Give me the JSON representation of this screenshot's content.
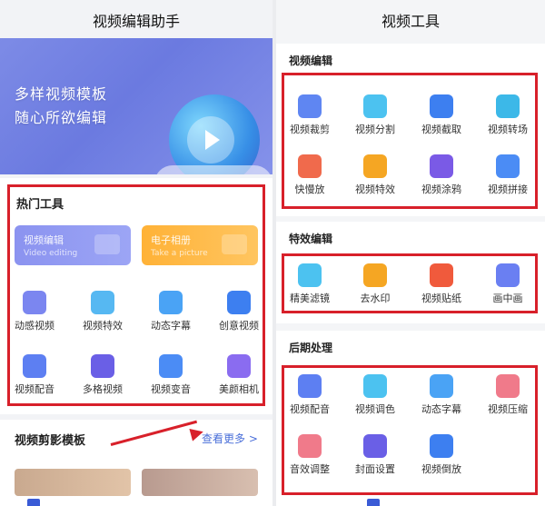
{
  "left": {
    "title": "视频编辑助手",
    "banner": {
      "line1": "多样视频模板",
      "line2": "随心所欲编辑"
    },
    "hot_tools": {
      "title": "热门工具",
      "big_buttons": [
        {
          "label": "视频编辑",
          "sub": "Video editing",
          "color": "#8b93f0"
        },
        {
          "label": "电子相册",
          "sub": "Take a picture",
          "color": "#ffb237"
        }
      ],
      "items": [
        {
          "label": "动感视频",
          "icon": "video-motion-icon",
          "color": "#7b86f0"
        },
        {
          "label": "视频特效",
          "icon": "video-effect-icon",
          "color": "#56b8f2"
        },
        {
          "label": "动态字幕",
          "icon": "subtitle-icon",
          "color": "#4aa3f5"
        },
        {
          "label": "创意视频",
          "icon": "api-icon",
          "color": "#3d7ff0"
        },
        {
          "label": "视频配音",
          "icon": "voiceover-icon",
          "color": "#5d7ff2"
        },
        {
          "label": "多格视频",
          "icon": "grid-video-icon",
          "color": "#6a5fe6"
        },
        {
          "label": "视频变音",
          "icon": "voice-change-icon",
          "color": "#4b8cf5"
        },
        {
          "label": "美颜相机",
          "icon": "beauty-camera-icon",
          "color": "#8a6cf0"
        }
      ]
    },
    "templates": {
      "title": "视频剪影模板",
      "more": "查看更多 >"
    }
  },
  "right": {
    "title": "视频工具",
    "sections": [
      {
        "title": "视频编辑",
        "items": [
          {
            "label": "视频裁剪",
            "icon": "crop-icon",
            "color": "#5f86f2"
          },
          {
            "label": "视频分割",
            "icon": "split-icon",
            "color": "#4cc2f0"
          },
          {
            "label": "视频截取",
            "icon": "capture-icon",
            "color": "#3d7ff0"
          },
          {
            "label": "视频转场",
            "icon": "transition-icon",
            "color": "#3cb8e8"
          },
          {
            "label": "快慢放",
            "icon": "speed-icon",
            "color": "#f06a4c"
          },
          {
            "label": "视频特效",
            "icon": "effect-icon",
            "color": "#f5a623"
          },
          {
            "label": "视频涂鸦",
            "icon": "doodle-icon",
            "color": "#7a5ae6"
          },
          {
            "label": "视频拼接",
            "icon": "splice-icon",
            "color": "#4b8cf5"
          }
        ]
      },
      {
        "title": "特效编辑",
        "items": [
          {
            "label": "精美滤镜",
            "icon": "filter-icon",
            "color": "#4cc2f0"
          },
          {
            "label": "去水印",
            "icon": "watermark-icon",
            "color": "#f5a623"
          },
          {
            "label": "视频贴纸",
            "icon": "sticker-icon",
            "color": "#f05a3c"
          },
          {
            "label": "画中画",
            "icon": "pip-icon",
            "color": "#6a7ff2"
          }
        ]
      },
      {
        "title": "后期处理",
        "items": [
          {
            "label": "视频配音",
            "icon": "dub-icon",
            "color": "#5d7ff2"
          },
          {
            "label": "视频调色",
            "icon": "color-grade-icon",
            "color": "#4cc2f0"
          },
          {
            "label": "动态字幕",
            "icon": "dynamic-subtitle-icon",
            "color": "#4aa3f5"
          },
          {
            "label": "视频压缩",
            "icon": "compress-icon",
            "color": "#f07a8a"
          },
          {
            "label": "音效调整",
            "icon": "sound-adjust-icon",
            "color": "#f07a8a"
          },
          {
            "label": "封面设置",
            "icon": "cover-icon",
            "color": "#6a5fe6"
          },
          {
            "label": "视频倒放",
            "icon": "reverse-icon",
            "color": "#3d7ff0"
          }
        ]
      }
    ]
  }
}
